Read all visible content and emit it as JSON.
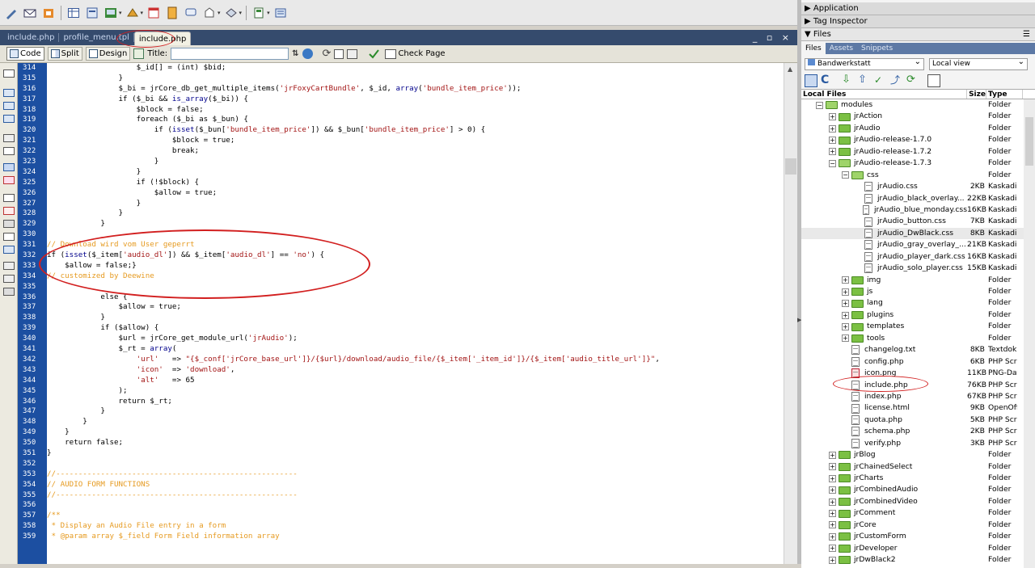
{
  "tabs": [
    "include.php",
    "profile_menu.tpl",
    "include.php"
  ],
  "window_controls": "_ ▫ ×",
  "doc_toolbar": {
    "code": "Code",
    "split": "Split",
    "design": "Design",
    "title_label": "Title:",
    "title_value": "",
    "check_page": "Check Page"
  },
  "code": {
    "first_line": 314,
    "lines": [
      "                    $_id[] = (int) $bid;",
      "                }",
      "                $_bi = jrCore_db_get_multiple_items('jrFoxyCartBundle', $_id, array('bundle_item_price'));",
      "                if ($_bi && is_array($_bi)) {",
      "                    $block = false;",
      "                    foreach ($_bi as $_bun) {",
      "                        if (isset($_bun['bundle_item_price']) && $_bun['bundle_item_price'] > 0) {",
      "                            $block = true;",
      "                            break;",
      "                        }",
      "                    }",
      "                    if (!$block) {",
      "                        $allow = true;",
      "                    }",
      "                }",
      "            }",
      "",
      "// Download wird vom User geperrt",
      "if (isset($_item['audio_dl']) && $_item['audio_dl'] == 'no') {",
      "    $allow = false;}",
      "// customized by Deewine",
      "",
      "            else {",
      "                $allow = true;",
      "            }",
      "            if ($allow) {",
      "                $url = jrCore_get_module_url('jrAudio');",
      "                $_rt = array(",
      "                    'url'   => \"{$_conf['jrCore_base_url']}/{$url}/download/audio_file/{$_item['_item_id']}/{$_item['audio_title_url']}\",",
      "                    'icon'  => 'download',",
      "                    'alt'   => 65",
      "                );",
      "                return $_rt;",
      "            }",
      "        }",
      "    }",
      "    return false;",
      "}",
      "",
      "//------------------------------------------------------",
      "// AUDIO FORM FUNCTIONS",
      "//------------------------------------------------------",
      "",
      "/**",
      " * Display an Audio File entry in a form",
      " * @param array $_field Form Field information array"
    ]
  },
  "panels": {
    "application": "Application",
    "tag_inspector": "Tag Inspector",
    "files": "Files"
  },
  "files_panel": {
    "tabs": [
      "Files",
      "Assets",
      "Snippets"
    ],
    "site": "Bandwerkstatt",
    "view": "Local view",
    "col_local": "Local Files",
    "col_size": "Size",
    "col_type": "Type",
    "rows": [
      {
        "name": "modules",
        "size": "",
        "type": "Folder",
        "level": 0,
        "kind": "folder-open",
        "pm": "−"
      },
      {
        "name": "jrAction",
        "size": "",
        "type": "Folder",
        "level": 1,
        "kind": "folder",
        "pm": "+"
      },
      {
        "name": "jrAudio",
        "size": "",
        "type": "Folder",
        "level": 1,
        "kind": "folder",
        "pm": "+"
      },
      {
        "name": "jrAudio-release-1.7.0",
        "size": "",
        "type": "Folder",
        "level": 1,
        "kind": "folder",
        "pm": "+"
      },
      {
        "name": "jrAudio-release-1.7.2",
        "size": "",
        "type": "Folder",
        "level": 1,
        "kind": "folder",
        "pm": "+"
      },
      {
        "name": "jrAudio-release-1.7.3",
        "size": "",
        "type": "Folder",
        "level": 1,
        "kind": "folder-open",
        "pm": "−"
      },
      {
        "name": "css",
        "size": "",
        "type": "Folder",
        "level": 2,
        "kind": "folder-open",
        "pm": "−"
      },
      {
        "name": "jrAudio.css",
        "size": "2KB",
        "type": "Kaskadie...",
        "level": 3,
        "kind": "file"
      },
      {
        "name": "jrAudio_black_overlay...",
        "size": "22KB",
        "type": "Kaskadie...",
        "level": 3,
        "kind": "file"
      },
      {
        "name": "jrAudio_blue_monday.css",
        "size": "16KB",
        "type": "Kaskadie...",
        "level": 3,
        "kind": "file"
      },
      {
        "name": "jrAudio_button.css",
        "size": "7KB",
        "type": "Kaskadie...",
        "level": 3,
        "kind": "file"
      },
      {
        "name": "jrAudio_DwBlack.css",
        "size": "8KB",
        "type": "Kaskadie...",
        "level": 3,
        "kind": "file",
        "hl": true
      },
      {
        "name": "jrAudio_gray_overlay_...",
        "size": "21KB",
        "type": "Kaskadie...",
        "level": 3,
        "kind": "file"
      },
      {
        "name": "jrAudio_player_dark.css",
        "size": "16KB",
        "type": "Kaskadie...",
        "level": 3,
        "kind": "file"
      },
      {
        "name": "jrAudio_solo_player.css",
        "size": "15KB",
        "type": "Kaskadie...",
        "level": 3,
        "kind": "file"
      },
      {
        "name": "img",
        "size": "",
        "type": "Folder",
        "level": 2,
        "kind": "folder",
        "pm": "+"
      },
      {
        "name": "js",
        "size": "",
        "type": "Folder",
        "level": 2,
        "kind": "folder",
        "pm": "+"
      },
      {
        "name": "lang",
        "size": "",
        "type": "Folder",
        "level": 2,
        "kind": "folder",
        "pm": "+"
      },
      {
        "name": "plugins",
        "size": "",
        "type": "Folder",
        "level": 2,
        "kind": "folder",
        "pm": "+"
      },
      {
        "name": "templates",
        "size": "",
        "type": "Folder",
        "level": 2,
        "kind": "folder",
        "pm": "+"
      },
      {
        "name": "tools",
        "size": "",
        "type": "Folder",
        "level": 2,
        "kind": "folder",
        "pm": "+"
      },
      {
        "name": "changelog.txt",
        "size": "8KB",
        "type": "Textdok...",
        "level": 2,
        "kind": "file"
      },
      {
        "name": "config.php",
        "size": "6KB",
        "type": "PHP Scrip",
        "level": 2,
        "kind": "file"
      },
      {
        "name": "icon.png",
        "size": "11KB",
        "type": "PNG-Date",
        "level": 2,
        "kind": "file-png"
      },
      {
        "name": "include.php",
        "size": "76KB",
        "type": "PHP Scrip",
        "level": 2,
        "kind": "file"
      },
      {
        "name": "index.php",
        "size": "67KB",
        "type": "PHP Scrip",
        "level": 2,
        "kind": "file"
      },
      {
        "name": "license.html",
        "size": "9KB",
        "type": "OpenOffi...",
        "level": 2,
        "kind": "file"
      },
      {
        "name": "quota.php",
        "size": "5KB",
        "type": "PHP Scrip",
        "level": 2,
        "kind": "file"
      },
      {
        "name": "schema.php",
        "size": "2KB",
        "type": "PHP Scrip",
        "level": 2,
        "kind": "file"
      },
      {
        "name": "verify.php",
        "size": "3KB",
        "type": "PHP Scrip",
        "level": 2,
        "kind": "file"
      },
      {
        "name": "jrBlog",
        "size": "",
        "type": "Folder",
        "level": 1,
        "kind": "folder",
        "pm": "+"
      },
      {
        "name": "jrChainedSelect",
        "size": "",
        "type": "Folder",
        "level": 1,
        "kind": "folder",
        "pm": "+"
      },
      {
        "name": "jrCharts",
        "size": "",
        "type": "Folder",
        "level": 1,
        "kind": "folder",
        "pm": "+"
      },
      {
        "name": "jrCombinedAudio",
        "size": "",
        "type": "Folder",
        "level": 1,
        "kind": "folder",
        "pm": "+"
      },
      {
        "name": "jrCombinedVideo",
        "size": "",
        "type": "Folder",
        "level": 1,
        "kind": "folder",
        "pm": "+"
      },
      {
        "name": "jrComment",
        "size": "",
        "type": "Folder",
        "level": 1,
        "kind": "folder",
        "pm": "+"
      },
      {
        "name": "jrCore",
        "size": "",
        "type": "Folder",
        "level": 1,
        "kind": "folder",
        "pm": "+"
      },
      {
        "name": "jrCustomForm",
        "size": "",
        "type": "Folder",
        "level": 1,
        "kind": "folder",
        "pm": "+"
      },
      {
        "name": "jrDeveloper",
        "size": "",
        "type": "Folder",
        "level": 1,
        "kind": "folder",
        "pm": "+"
      },
      {
        "name": "jrDwBlack2",
        "size": "",
        "type": "Folder",
        "level": 1,
        "kind": "folder",
        "pm": "+"
      }
    ]
  },
  "colors": {
    "gutter": "#1c4fa1",
    "comment": "#e69b22",
    "string": "#a31515",
    "keyword": "#00008b",
    "annotation": "#d21f1f"
  }
}
